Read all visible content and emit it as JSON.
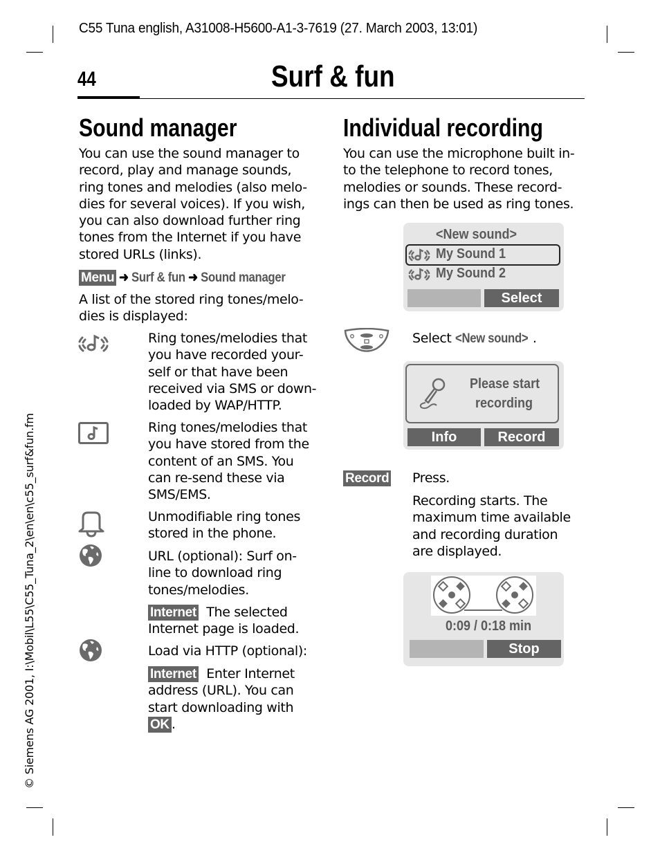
{
  "header": {
    "doc_info": "C55 Tuna english, A31008-H5600-A1-3-7619 (27. March 2003, 13:01)",
    "page_number": "44",
    "chapter_title": "Surf & fun"
  },
  "side_note": "© Siemens AG 2001, I:\\Mobil\\L55\\C55_Tuna_2\\en\\en\\c55_surf&fun.fm",
  "sound_manager": {
    "title": "Sound manager",
    "intro": [
      "You can use the sound manager to",
      "record, play and manage sounds,",
      "ring tones and melodies (also melo-",
      "dies for several voices). If you wish,",
      "you can also download further ring",
      "tones from the Internet if you have",
      "stored URLs (links)."
    ],
    "menu_path": {
      "softkey": "Menu",
      "arrow": "➜",
      "step1": "Surf & fun",
      "step2": "Sound manager"
    },
    "list_intro": [
      "A list of the stored ring tones/melo-",
      "dies is displayed:"
    ],
    "items": [
      {
        "icon": "recorded-sound-icon",
        "lines": [
          "Ring tones/melodies that",
          "you have recorded your-",
          "self or that have been",
          "received via SMS or down-",
          "loaded by WAP/HTTP."
        ]
      },
      {
        "icon": "sms-melody-icon",
        "lines": [
          "Ring tones/melodies that",
          "you have stored from the",
          "content of an SMS. You",
          "can re-send these via",
          "SMS/EMS."
        ]
      },
      {
        "icon": "bell-icon",
        "lines": [
          "Unmodifiable ring tones",
          "stored in the phone."
        ]
      },
      {
        "icon": "globe-icon",
        "lines": [
          "URL (optional): Surf on-",
          "line to download ring",
          "tones/melodies."
        ],
        "sub": {
          "softkey": "Internet",
          "lines": [
            "The selected",
            "Internet page is loaded."
          ]
        }
      },
      {
        "icon": "globe-icon",
        "lines": [
          "Load via HTTP (optional):"
        ],
        "sub": {
          "softkey": "Internet",
          "lines": [
            "Enter Internet",
            "address (URL). You can",
            "start downloading with"
          ],
          "end_softkey": "OK",
          "end_text": "."
        }
      }
    ]
  },
  "individual_recording": {
    "title": "Individual recording",
    "intro": [
      "You can use the microphone built in-",
      "to the telephone to record tones,",
      "melodies or sounds. These record-",
      "ings can then be used as ring tones."
    ],
    "screen1": {
      "items": [
        "<New sound>",
        "My Sound 1",
        "My Sound 2"
      ],
      "selected_index": 1,
      "softkey_left": "",
      "softkey_right": "Select"
    },
    "step1": {
      "icon": "navigation-key-icon",
      "text": "Select ",
      "highlight": "<New sound>",
      "end": "."
    },
    "screen2": {
      "message": [
        "Please start",
        "recording"
      ],
      "softkey_left": "Info",
      "softkey_right": "Record"
    },
    "step2": {
      "softkey": "Record",
      "text": "Press.",
      "detail": [
        "Recording starts. The",
        "maximum time available",
        "and recording duration",
        "are displayed."
      ]
    },
    "screen3": {
      "time": "0:09 / 0:18 min",
      "softkey_left": "",
      "softkey_right": "Stop"
    }
  }
}
